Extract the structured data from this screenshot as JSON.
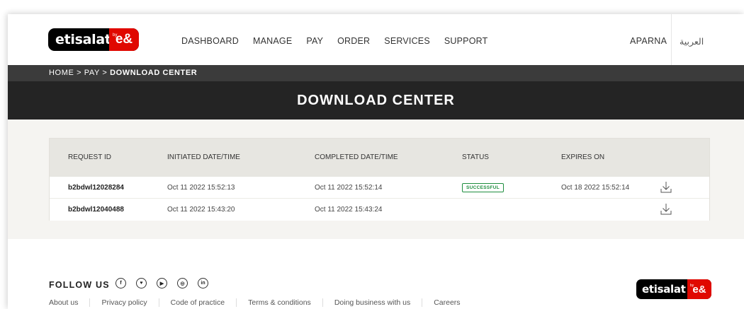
{
  "brand": {
    "name": "etisalat",
    "mark": "e&",
    "by": "by"
  },
  "nav": {
    "items": [
      {
        "label": "DASHBOARD"
      },
      {
        "label": "MANAGE"
      },
      {
        "label": "PAY"
      },
      {
        "label": "ORDER"
      },
      {
        "label": "SERVICES"
      },
      {
        "label": "SUPPORT"
      }
    ],
    "user": "APARNA",
    "language": "العربية"
  },
  "breadcrumb": {
    "items": [
      "HOME",
      "PAY"
    ],
    "separator": ">",
    "current": "DOWNLOAD CENTER"
  },
  "page": {
    "title": "DOWNLOAD CENTER"
  },
  "table": {
    "headers": [
      "REQUEST ID",
      "INITIATED DATE/TIME",
      "COMPLETED DATE/TIME",
      "STATUS",
      "EXPIRES ON"
    ],
    "rows": [
      {
        "request_id": "b2bdwl12028284",
        "initiated": "Oct 11 2022 15:52:13",
        "completed": "Oct 11 2022 15:52:14",
        "status": "SUCCESSFUL",
        "expires": "Oct 18 2022 15:52:14",
        "action_icon": "download-icon"
      },
      {
        "request_id": "b2bdwl12040488",
        "initiated": "Oct 11 2022 15:43:20",
        "completed": "Oct 11 2022 15:43:24",
        "status": "",
        "expires": "",
        "action_icon": "download-icon"
      }
    ]
  },
  "footer": {
    "follow_label": "FOLLOW US",
    "socials": [
      {
        "icon": "facebook-icon",
        "glyph": "f"
      },
      {
        "icon": "twitter-icon",
        "glyph": "♥"
      },
      {
        "icon": "youtube-icon",
        "glyph": "▶"
      },
      {
        "icon": "instagram-icon",
        "glyph": "◎"
      },
      {
        "icon": "linkedin-icon",
        "glyph": "in"
      }
    ],
    "links": [
      "About us",
      "Privacy policy",
      "Code of practice",
      "Terms & conditions",
      "Doing business with us",
      "Careers"
    ]
  },
  "colors": {
    "brand_red": "#e00800",
    "status_green": "#1e8e3e",
    "hero_dark": "#242424"
  }
}
